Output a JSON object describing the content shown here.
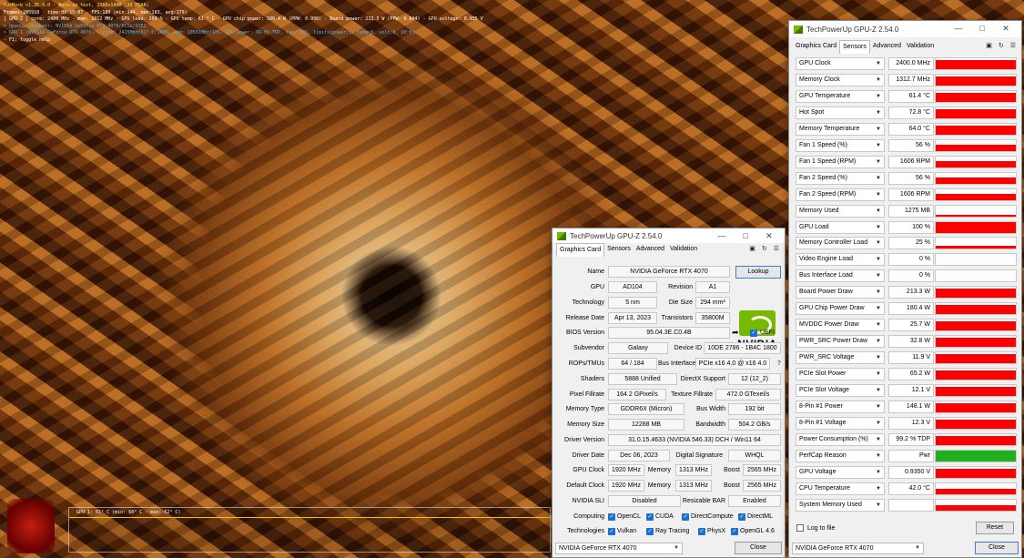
{
  "furmark": {
    "lines": [
      "FurMark v1.35.0.0 - Burn-in test, 2560x1440 (2X MSAA)",
      "Frames:285918 - time:00:15:07 - FPS:180 (min:144, max:183, avg:179)",
      "[ GPU-Z ] core: 2400 MHz - mem: 1312 MHz - GPU load: 100 % - GPU temp: 61 ° C - GPU chip power: 180.4 W (PPW: 0.998) - Board power: 213.3 W (PPW: 0.844) - GPU voltage: 0.935 V",
      "> OpenGL renderer: NVIDIA GeForce RTX 4070/PCIe/SSE2",
      "> GPU 1 (NVIDIA GeForce RTX 4070) - core: 2415MHz/61° C/100%, mem: 10501MHz/10%, GPU power: 99.0% TDP, fan: 56%, limits[power:1, temp:0, volt:0, OV:0]",
      "- F1: toggle help"
    ],
    "graph_label": "GPU 1: 61° C (min: 60° C - max: 62° C)"
  },
  "gc_window": {
    "title": "TechPowerUp GPU-Z 2.54.0",
    "tabs": [
      "Graphics Card",
      "Sensors",
      "Advanced",
      "Validation"
    ],
    "tab_icons": [
      "camera-icon",
      "refresh-icon",
      "menu-icon"
    ],
    "fields": {
      "name_label": "Name",
      "name": "NVIDIA GeForce RTX 4070",
      "lookup": "Lookup",
      "gpu_label": "GPU",
      "gpu": "AD104",
      "revision_label": "Revision",
      "revision": "A1",
      "technology_label": "Technology",
      "technology": "5 nm",
      "die_size_label": "Die Size",
      "die_size": "294 mm²",
      "release_date_label": "Release Date",
      "release_date": "Apr 13, 2023",
      "transistors_label": "Transistors",
      "transistors": "35800M",
      "bios_label": "BIOS Version",
      "bios": "95.04.3E.C0.4B",
      "uefi": "UEFI",
      "subvendor_label": "Subvendor",
      "subvendor": "Galaxy",
      "device_id_label": "Device ID",
      "device_id": "10DE 2786 - 1B4C 1800",
      "rops_label": "ROPs/TMUs",
      "rops": "64 / 184",
      "bus_interface_label": "Bus Interface",
      "bus_interface": "PCIe x16 4.0 @ x16 4.0",
      "help": "?",
      "shaders_label": "Shaders",
      "shaders": "5888 Unified",
      "directx_label": "DirectX Support",
      "directx": "12 (12_2)",
      "pixel_fillrate_label": "Pixel Fillrate",
      "pixel_fillrate": "164.2 GPixel/s",
      "texture_fillrate_label": "Texture Fillrate",
      "texture_fillrate": "472.0 GTexel/s",
      "memory_type_label": "Memory Type",
      "memory_type": "GDDR6X (Micron)",
      "bus_width_label": "Bus Width",
      "bus_width": "192 bit",
      "memory_size_label": "Memory Size",
      "memory_size": "12288 MB",
      "bandwidth_label": "Bandwidth",
      "bandwidth": "504.2 GB/s",
      "driver_version_label": "Driver Version",
      "driver_version": "31.0.15.4633 (NVIDIA 546.33) DCH / Win11 64",
      "driver_date_label": "Driver Date",
      "driver_date": "Dec 06, 2023",
      "digital_signature_label": "Digital Signature",
      "digital_signature": "WHQL",
      "gpu_clock_label": "GPU Clock",
      "gpu_clock": "1920 MHz",
      "memory_label": "Memory",
      "memory_clock": "1313 MHz",
      "boost_label": "Boost",
      "boost": "2565 MHz",
      "default_clock_label": "Default Clock",
      "default_clock": "1920 MHz",
      "memory_label2": "Memory",
      "default_memory": "1313 MHz",
      "boost_label2": "Boost",
      "default_boost": "2565 MHz",
      "sli_label": "NVIDIA SLI",
      "sli": "Disabled",
      "resizable_bar_label": "Resizable BAR",
      "resizable_bar": "Enabled",
      "computing_label": "Computing",
      "technologies_label": "Technologies"
    },
    "computing": [
      "OpenCL",
      "CUDA",
      "DirectCompute",
      "DirectML"
    ],
    "technologies": [
      "Vulkan",
      "Ray Tracing",
      "PhysX",
      "OpenGL 4.6"
    ],
    "selected_gpu": "NVIDIA GeForce RTX 4070",
    "close": "Close",
    "nvidia_word": "NVIDIA"
  },
  "sensors_window": {
    "title": "TechPowerUp GPU-Z 2.54.0",
    "tabs": [
      "Graphics Card",
      "Sensors",
      "Advanced",
      "Validation"
    ],
    "rows": [
      {
        "name": "GPU Clock",
        "value": "2400.0 MHz",
        "level": 0.85
      },
      {
        "name": "Memory Clock",
        "value": "1312.7 MHz",
        "level": 0.85
      },
      {
        "name": "GPU Temperature",
        "value": "61.4 °C",
        "level": 0.85
      },
      {
        "name": "Hot Spot",
        "value": "72.8 °C",
        "level": 0.85
      },
      {
        "name": "Memory Temperature",
        "value": "64.0 °C",
        "level": 0.85
      },
      {
        "name": "Fan 1 Speed (%)",
        "value": "56 %",
        "level": 0.55
      },
      {
        "name": "Fan 1 Speed (RPM)",
        "value": "1606 RPM",
        "level": 0.55
      },
      {
        "name": "Fan 2 Speed (%)",
        "value": "56 %",
        "level": 0.55
      },
      {
        "name": "Fan 2 Speed (RPM)",
        "value": "1606 RPM",
        "level": 0.55
      },
      {
        "name": "Memory Used",
        "value": "1275 MB",
        "level": 0.12
      },
      {
        "name": "GPU Load",
        "value": "100 %",
        "level": 1.0
      },
      {
        "name": "Memory Controller Load",
        "value": "25 %",
        "level": 0.25
      },
      {
        "name": "Video Engine Load",
        "value": "0 %",
        "level": 0
      },
      {
        "name": "Bus Interface Load",
        "value": "0 %",
        "level": 0
      },
      {
        "name": "Board Power Draw",
        "value": "213.3 W",
        "level": 0.85
      },
      {
        "name": "GPU Chip Power Draw",
        "value": "180.4 W",
        "level": 0.85
      },
      {
        "name": "MVDDC Power Draw",
        "value": "25.7 W",
        "level": 0.85
      },
      {
        "name": "PWR_SRC Power Draw",
        "value": "32.8 W",
        "level": 0.85
      },
      {
        "name": "PWR_SRC Voltage",
        "value": "11.9 V",
        "level": 0.85
      },
      {
        "name": "PCIe Slot Power",
        "value": "65.2 W",
        "level": 0.85
      },
      {
        "name": "PCIe Slot Voltage",
        "value": "12.1 V",
        "level": 0.85
      },
      {
        "name": "8-Pin #1 Power",
        "value": "148.1 W",
        "level": 0.85
      },
      {
        "name": "8-Pin #1 Voltage",
        "value": "12.3 V",
        "level": 0.85
      },
      {
        "name": "Power Consumption (%)",
        "value": "99.2 % TDP",
        "level": 0.85
      },
      {
        "name": "PerfCap Reason",
        "value": "Pwr",
        "level": 1.0,
        "green": true
      },
      {
        "name": "GPU Voltage",
        "value": "0.9350 V",
        "level": 0.85
      },
      {
        "name": "CPU Temperature",
        "value": "42.0 °C",
        "level": 0.5
      },
      {
        "name": "System Memory Used",
        "value": "",
        "level": 0.5
      }
    ],
    "log_to_file": "Log to file",
    "reset": "Reset",
    "selected_gpu": "NVIDIA GeForce RTX 4070",
    "close": "Close"
  },
  "colors": {
    "bar": "#ff0000",
    "perfcap": "#1fb01f",
    "accent": "#1a6fd0"
  }
}
